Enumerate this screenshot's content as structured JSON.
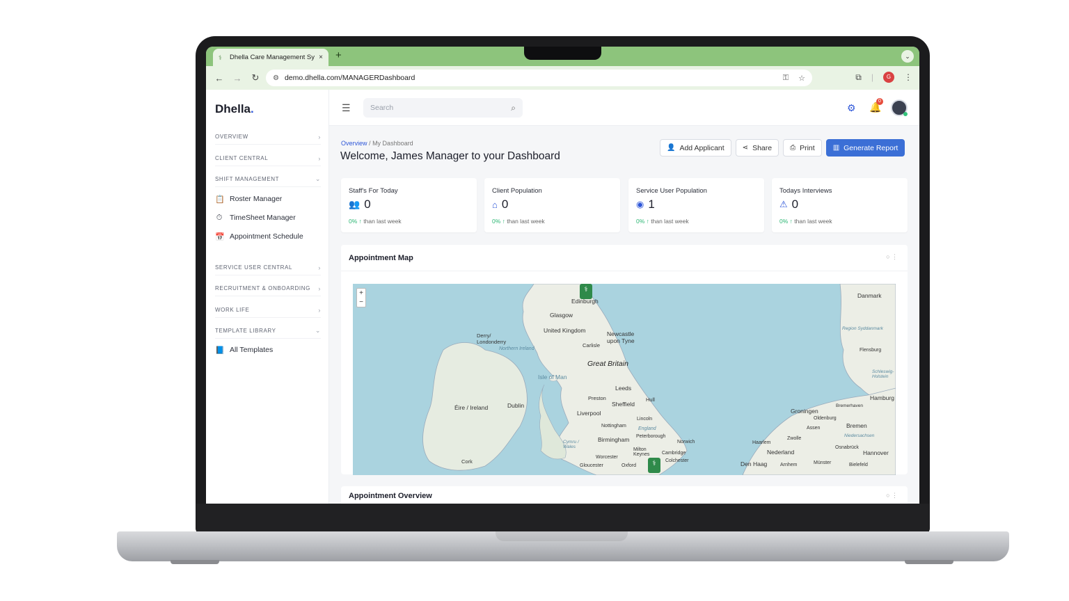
{
  "browser": {
    "tab_title": "Dhella Care Management Sys",
    "tab_close": "×",
    "new_tab": "+",
    "tab_menu": "⌄",
    "url": "demo.dhella.com/MANAGERDashboard",
    "profile_initial": "G"
  },
  "sidebar": {
    "logo": "Dhella",
    "logo_dot": ".",
    "sections": [
      {
        "label": "OVERVIEW",
        "chevron": "›"
      },
      {
        "label": "CLIENT CENTRAL",
        "chevron": "›"
      },
      {
        "label": "SHIFT MANAGEMENT",
        "chevron": "⌄"
      },
      {
        "label": "SERVICE USER CENTRAL",
        "chevron": "›"
      },
      {
        "label": "RECRUITMENT & ONBOARDING",
        "chevron": "›"
      },
      {
        "label": "WORK LIFE",
        "chevron": "›"
      },
      {
        "label": "TEMPLATE LIBRARY",
        "chevron": "⌄"
      }
    ],
    "items": [
      {
        "label": "Roster Manager",
        "icon": "clipboard-icon"
      },
      {
        "label": "TimeSheet Manager",
        "icon": "stopwatch-icon"
      },
      {
        "label": "Appointment Schedule",
        "icon": "calendar-icon"
      },
      {
        "label": "All Templates",
        "icon": "book-icon"
      }
    ]
  },
  "topbar": {
    "search_placeholder": "Search",
    "notification_count": "0"
  },
  "breadcrumb": {
    "root": "Overview",
    "separator": "/",
    "current": "My Dashboard"
  },
  "page_title": "Welcome, James Manager to your Dashboard",
  "actions": {
    "add_applicant": "Add Applicant",
    "share": "Share",
    "print": "Print",
    "generate_report": "Generate Report"
  },
  "stats": [
    {
      "label": "Staff's For Today",
      "value": "0",
      "change_pct": "0% ↑",
      "change_text": "than last week",
      "icon": "staff-icon"
    },
    {
      "label": "Client Population",
      "value": "0",
      "change_pct": "0% ↑",
      "change_text": "than last week",
      "icon": "house-icon"
    },
    {
      "label": "Service User Population",
      "value": "1",
      "change_pct": "0% ↑",
      "change_text": "than last week",
      "icon": "user-circle-icon"
    },
    {
      "label": "Todays Interviews",
      "value": "0",
      "change_pct": "0% ↑",
      "change_text": "than last week",
      "icon": "warning-triangle-icon"
    }
  ],
  "map_card": {
    "title": "Appointment Map",
    "zoom_in": "+",
    "zoom_out": "−",
    "labels": {
      "edinburgh": "Edinburgh",
      "glasgow": "Glasgow",
      "uk": "United Kingdom",
      "newcastle": "Newcastle upon Tyne",
      "carlisle": "Carlisle",
      "derry": "Derry/ Londonderry",
      "ni": "Northern Ireland",
      "great_britain": "Great Britain",
      "isle_of_man": "Isle of Man",
      "leeds": "Leeds",
      "preston": "Preston",
      "hull": "Hull",
      "sheffield": "Sheffield",
      "eire": "Éire / Ireland",
      "dublin": "Dublin",
      "liverpool": "Liverpool",
      "lincoln": "Lincoln",
      "nottingham": "Nottingham",
      "peterborough": "Peterborough",
      "norwich": "Norwich",
      "birmingham": "Birmingham",
      "england": "England",
      "wales": "Cymru / Wales",
      "milton": "Milton Keynes",
      "cambridge": "Cambridge",
      "colchester": "Colchester",
      "worcester": "Worcester",
      "gloucester": "Gloucester",
      "oxford": "Oxford",
      "cork": "Cork",
      "danmark": "Danmark",
      "syddanmark": "Region Syddanmark",
      "flensburg": "Flensburg",
      "schleswig": "Schleswig-Holstein",
      "hamburg": "Hamburg",
      "bremerhaven": "Bremerhaven",
      "groningen": "Groningen",
      "oldenburg": "Oldenburg",
      "bremen": "Bremen",
      "assen": "Assen",
      "niedersachsen": "Niedersachsen",
      "haarlem": "Haarlem",
      "zwolle": "Zwolle",
      "osnabruck": "Osnabrück",
      "nederland": "Nederland",
      "hannover": "Hannover",
      "den_haag": "Den Haag",
      "arnhem": "Arnhem",
      "munster": "Münster",
      "bielefeld": "Bielefeld"
    }
  },
  "overview_card": {
    "title": "Appointment Overview"
  }
}
